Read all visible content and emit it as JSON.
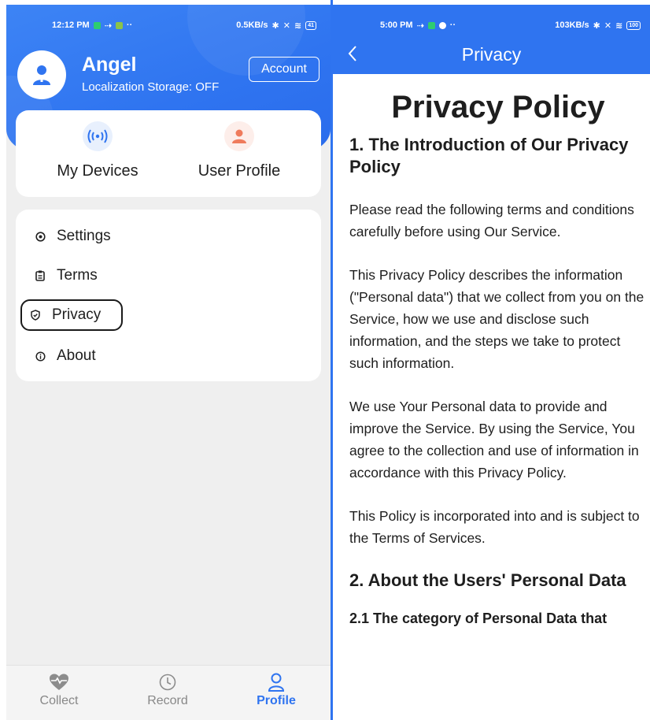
{
  "left_screen": {
    "status_bar": {
      "time": "12:12 PM",
      "dots": "··",
      "speed": "0.5KB/s",
      "battery": "41"
    },
    "profile": {
      "name": "Angel",
      "subtitle": "Localization Storage: OFF",
      "account_label": "Account"
    },
    "quick_actions": [
      {
        "label": "My Devices",
        "icon": "wireless-signal-icon"
      },
      {
        "label": "User Profile",
        "icon": "person-icon"
      }
    ],
    "menu": [
      {
        "label": "Settings",
        "icon": "settings-icon"
      },
      {
        "label": "Terms",
        "icon": "clipboard-icon"
      },
      {
        "label": "Privacy",
        "icon": "shield-icon"
      },
      {
        "label": "About",
        "icon": "info-icon"
      }
    ],
    "bottom_nav": [
      {
        "label": "Collect",
        "icon": "heart-pulse-icon"
      },
      {
        "label": "Record",
        "icon": "clock-icon"
      },
      {
        "label": "Profile",
        "icon": "user-icon",
        "active": true
      }
    ]
  },
  "right_screen": {
    "status_bar": {
      "time": "5:00 PM",
      "dots": "··",
      "speed": "103KB/s",
      "battery": "100"
    },
    "header": {
      "title": "Privacy"
    },
    "document": {
      "title": "Privacy Policy",
      "section1_heading": "1. The Introduction of Our Privacy Policy",
      "paragraphs": [
        "Please read the following terms and conditions carefully before using Our Service.",
        "This Privacy Policy describes the information (\"Personal data\") that we collect from you on the Service, how we use and disclose such information, and the steps we take to protect such information.",
        "We use Your Personal data to provide and improve the Service. By using the Service, You agree to the collection and use of information in accordance with this Privacy Policy.",
        "This Policy is incorporated into and is subject to the Terms of Services."
      ],
      "section2_heading": "2. About the Users' Personal Data",
      "section21_heading": "2.1 The category of Personal Data that"
    }
  },
  "colors": {
    "primary": "#2f74f0",
    "text": "#1e1e1e",
    "muted": "#888888",
    "background": "#efefef"
  }
}
